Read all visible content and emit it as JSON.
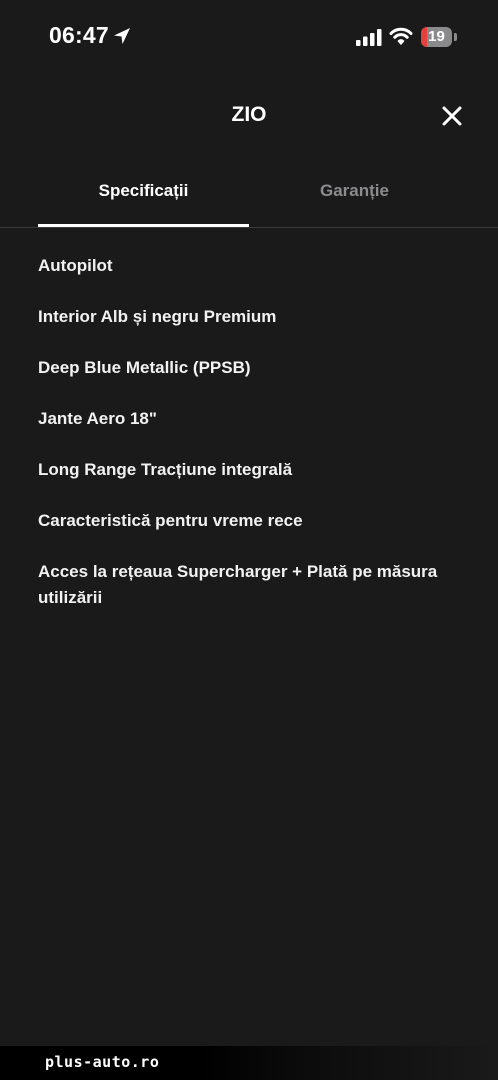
{
  "status_bar": {
    "time": "06:47",
    "battery_level": "19",
    "battery_fraction": 0.19,
    "battery_color": "#e5413a",
    "icons": [
      "location-arrow-icon",
      "cellular-signal-icon",
      "wifi-icon",
      "battery-icon"
    ]
  },
  "header": {
    "title": "ZIO",
    "close_icon": "close-icon"
  },
  "tabs": [
    {
      "label": "Specificații",
      "active": true
    },
    {
      "label": "Garanție",
      "active": false
    }
  ],
  "specs": [
    "Autopilot",
    "Interior Alb și negru Premium",
    "Deep Blue Metallic (PPSB)",
    "Jante Aero 18\"",
    "Long Range Tracțiune integrală",
    "Caracteristică pentru vreme rece",
    "Acces la rețeaua Supercharger + Plată pe măsura utilizării"
  ],
  "watermark": "plus-auto.ro",
  "colors": {
    "background": "#1a1a1b",
    "text": "#f2f2f2",
    "inactive_tab": "#8c8c8e",
    "divider": "#3a3a3c"
  }
}
